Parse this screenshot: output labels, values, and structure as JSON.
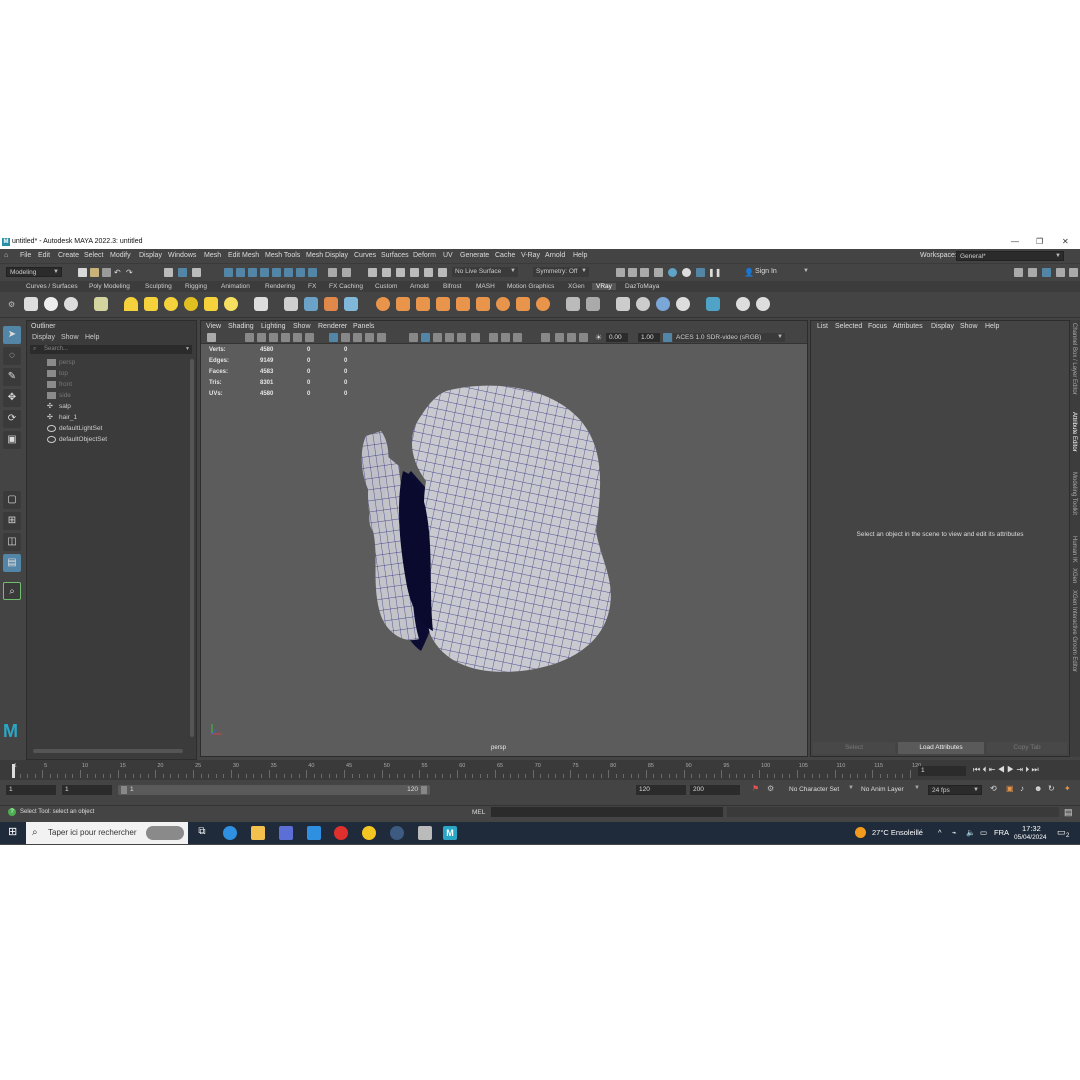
{
  "window": {
    "title": "untitled* - Autodesk MAYA 2022.3: untitled",
    "logo": "M"
  },
  "menubar": {
    "items": [
      "File",
      "Edit",
      "Create",
      "Select",
      "Modify",
      "Display",
      "Windows",
      "Mesh",
      "Edit Mesh",
      "Mesh Tools",
      "Mesh Display",
      "Curves",
      "Surfaces",
      "Deform",
      "UV",
      "Generate",
      "Cache",
      "V-Ray",
      "Arnold",
      "Help"
    ],
    "workspace_label": "Workspace:",
    "workspace_value": "General*"
  },
  "statusline": {
    "menuset": "Modeling",
    "live_surface": "No Live Surface",
    "symmetry": "Symmetry: Off",
    "sign_in": "Sign In"
  },
  "shelf": {
    "tabs": [
      "Curves / Surfaces",
      "Poly Modeling",
      "Sculpting",
      "Rigging",
      "Animation",
      "Rendering",
      "FX",
      "FX Caching",
      "Custom",
      "Arnold",
      "Bifrost",
      "MASH",
      "Motion Graphics",
      "XGen",
      "VRay",
      "DazToMaya"
    ],
    "selected": "VRay"
  },
  "outliner": {
    "title": "Outliner",
    "menu": [
      "Display",
      "Show",
      "Help"
    ],
    "search_placeholder": "Search...",
    "items": [
      {
        "label": "persp",
        "icon": "camera-icon",
        "dim": true
      },
      {
        "label": "top",
        "icon": "camera-icon",
        "dim": true
      },
      {
        "label": "front",
        "icon": "camera-icon",
        "dim": true
      },
      {
        "label": "side",
        "icon": "camera-icon",
        "dim": true
      },
      {
        "label": "salp",
        "icon": "mesh-icon",
        "dim": false
      },
      {
        "label": "hair_1",
        "icon": "mesh-icon",
        "dim": false
      },
      {
        "label": "defaultLightSet",
        "icon": "set-icon",
        "dim": false
      },
      {
        "label": "defaultObjectSet",
        "icon": "set-icon",
        "dim": false
      }
    ]
  },
  "viewport": {
    "menu": [
      "View",
      "Shading",
      "Lighting",
      "Show",
      "Renderer",
      "Panels"
    ],
    "exposure": "0.00",
    "gamma": "1.00",
    "color_space": "ACES 1.0 SDR-video (sRGB)",
    "hud": [
      {
        "label": "Verts:",
        "values": [
          "4580",
          "0",
          "0"
        ]
      },
      {
        "label": "Edges:",
        "values": [
          "9149",
          "0",
          "0"
        ]
      },
      {
        "label": "Faces:",
        "values": [
          "4583",
          "0",
          "0"
        ]
      },
      {
        "label": "Tris:",
        "values": [
          "8301",
          "0",
          "0"
        ]
      },
      {
        "label": "UVs:",
        "values": [
          "4580",
          "0",
          "0"
        ]
      }
    ],
    "camera_label": "persp"
  },
  "attribute_editor": {
    "menu": [
      "List",
      "Selected",
      "Focus",
      "Attributes",
      "Display",
      "Show",
      "Help"
    ],
    "message": "Select an object in the scene to view and edit its attributes",
    "buttons": {
      "select": "Select",
      "load": "Load Attributes",
      "copy": "Copy Tab"
    }
  },
  "side_tabs": [
    "Channel Box / Layer Editor",
    "Attribute Editor",
    "Modeling Toolkit",
    "Human IK",
    "XGen",
    "XGen Interactive Groom Editor"
  ],
  "timeslider": {
    "ticks": [
      "1",
      "5",
      "10",
      "15",
      "20",
      "25",
      "30",
      "35",
      "40",
      "45",
      "50",
      "55",
      "60",
      "65",
      "70",
      "75",
      "80",
      "85",
      "90",
      "95",
      "100",
      "105",
      "110",
      "115",
      "120"
    ],
    "current_frame": "1"
  },
  "rangeslider": {
    "start": "1",
    "anim_start": "1",
    "range_start": "1",
    "range_end": "120",
    "anim_end": "120",
    "end": "200",
    "character_set": "No Character Set",
    "anim_layer": "No Anim Layer",
    "fps": "24 fps"
  },
  "cmdline": {
    "help": "Select Tool: select an object",
    "lang": "MEL"
  },
  "taskbar": {
    "search": "Taper ici pour rechercher",
    "weather": "27°C  Ensoleillé",
    "lang": "FRA",
    "time": "17:32",
    "date": "05/04/2024",
    "notif": "2"
  },
  "colors": {
    "accent": "#5285a6",
    "wire": "#26267a",
    "mesh": "#c9cad0"
  }
}
